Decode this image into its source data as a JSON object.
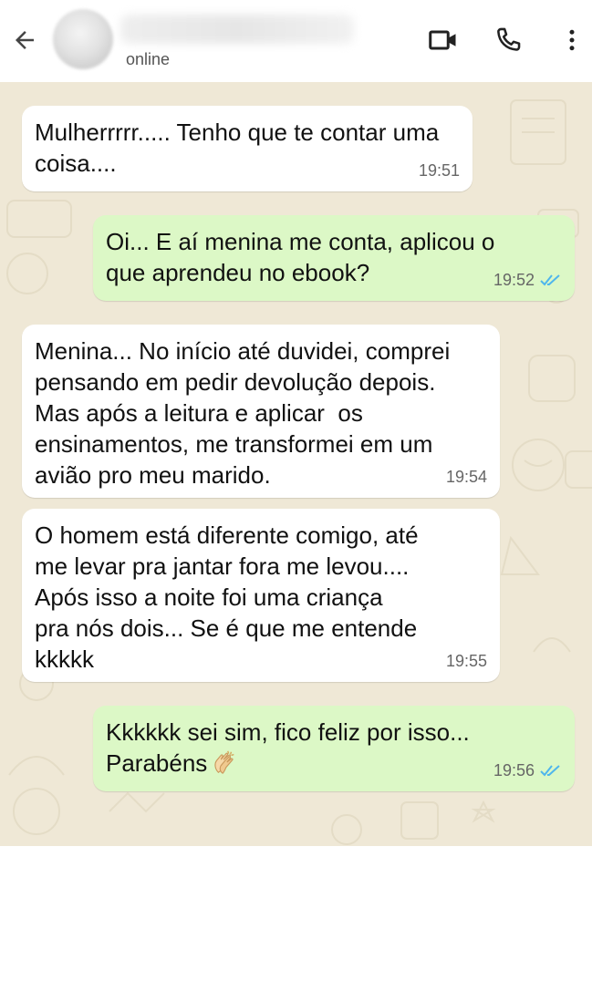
{
  "header": {
    "status": "online",
    "icons": {
      "back": "arrow-left-icon",
      "video": "video-camera-icon",
      "call": "phone-icon",
      "menu": "more-vertical-icon"
    }
  },
  "colors": {
    "incoming_bubble": "#ffffff",
    "outgoing_bubble": "#dcf8c6",
    "chat_background": "#efe8d6",
    "read_ticks": "#4fb6ec"
  },
  "messages": [
    {
      "direction": "incoming",
      "text": "Mulherrrrr..... Tenho que te contar uma\ncoisa....",
      "time": "19:51"
    },
    {
      "direction": "outgoing",
      "text": "Oi... E aí menina me conta, aplicou o\nque aprendeu no ebook?",
      "time": "19:52",
      "read": true
    },
    {
      "direction": "incoming",
      "text": "Menina... No início até duvidei, comprei\npensando em pedir devolução depois.\nMas após a leitura e aplicar  os\nensinamentos, me transformei em um\navião pro meu marido.",
      "time": "19:54"
    },
    {
      "direction": "incoming",
      "text": "O homem está diferente comigo, até\nme levar pra jantar fora me levou....\nApós isso a noite foi uma criança\npra nós dois... Se é que me entende\nkkkkk",
      "time": "19:55"
    },
    {
      "direction": "outgoing",
      "text": "Kkkkkk sei sim, fico feliz por isso...\nParabéns",
      "emoji": "clapping-hands-icon",
      "time": "19:56",
      "read": true
    }
  ]
}
